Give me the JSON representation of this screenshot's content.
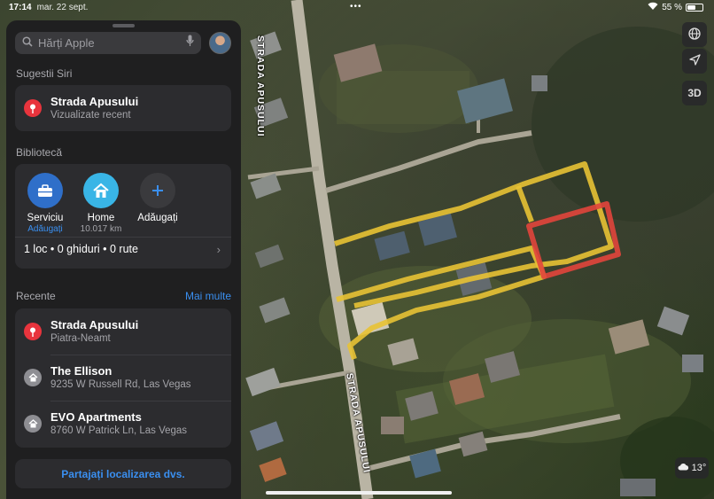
{
  "status_bar": {
    "time": "17:14",
    "date": "mar. 22 sept.",
    "battery": "55 %",
    "battery_level": 0.55
  },
  "search": {
    "placeholder": "Hărți Apple",
    "search_icon": "search-icon",
    "mic_icon": "microphone-icon"
  },
  "siri": {
    "heading": "Sugestii Siri",
    "item": {
      "title": "Strada Apusului",
      "subtitle": "Vizualizate recent",
      "icon": "map-pin-icon",
      "color": "#e8343d"
    }
  },
  "library": {
    "heading": "Bibliotecă",
    "items": [
      {
        "label": "Serviciu",
        "sub": "Adăugați",
        "icon": "briefcase-icon",
        "color": "#2f6fc9"
      },
      {
        "label": "Home",
        "sub": "10.017 km",
        "icon": "house-icon",
        "color": "#39b5e6"
      },
      {
        "label": "Adăugați",
        "sub": "",
        "icon": "plus-icon",
        "color": "#3a3a3d"
      }
    ],
    "summary": "1 loc • 0 ghiduri • 0 rute"
  },
  "recents": {
    "heading": "Recente",
    "more": "Mai multe",
    "items": [
      {
        "title": "Strada Apusului",
        "subtitle": "Piatra-Neamt",
        "icon": "map-pin-icon"
      },
      {
        "title": "The Ellison",
        "subtitle": "9235 W Russell Rd, Las Vegas",
        "icon": "building-icon"
      },
      {
        "title": "EVO Apartments",
        "subtitle": "8760 W Patrick Ln, Las Vegas",
        "icon": "building-icon"
      }
    ]
  },
  "share_button": "Partajați localizarea dvs.",
  "map": {
    "street_name": "STRADA APUSULUI",
    "controls": {
      "globe": "globe-icon",
      "location": "location-arrow-icon",
      "view_3d": "3D"
    },
    "weather": {
      "icon": "cloud-icon",
      "temp": "13°"
    },
    "outline_colors": {
      "yellow": "#e8c234",
      "red": "#e2453c"
    }
  }
}
